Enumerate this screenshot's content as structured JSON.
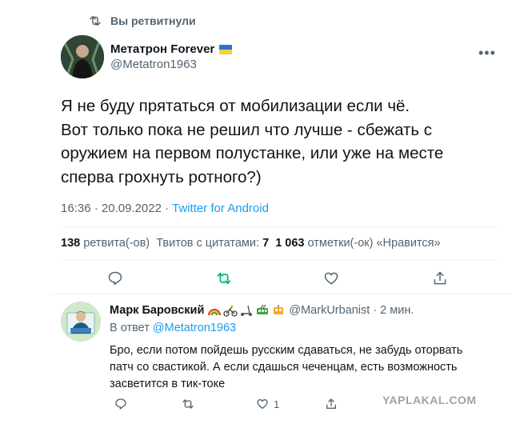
{
  "retweet_header": {
    "label": "Вы ретвитнули"
  },
  "tweet": {
    "author_name": "Метатрон Forever",
    "author_handle": "@Metatron1963",
    "text_lines": [
      "Я не буду прятаться от мобилизации если чё.",
      "Вот только пока не решил что лучше - сбежать с",
      "оружием на первом полустанке, или уже на месте",
      "сперва грохнуть ротного?)"
    ],
    "time": "16:36",
    "date": "20.09.2022",
    "separator": "·",
    "source": "Twitter for Android",
    "stats": {
      "retweets_count": "138",
      "retweets_label": "ретвита(-ов)",
      "quotes_label": "Твитов с цитатами:",
      "quotes_count": "7",
      "likes_count": "1 063",
      "likes_label": "отметки(-ок) «Нравится»"
    }
  },
  "reply": {
    "author_name": "Марк Баровский",
    "author_handle": "@MarkUrbanist",
    "time_ago": "· 2 мин.",
    "reply_to_label": "В ответ",
    "reply_to_handle": "@Metatron1963",
    "text_lines": [
      "Бро, если потом пойдешь русским сдаваться, не забудь оторвать",
      "патч со свастикой. А если сдашься чеченцам, есть возможность",
      "засветится в тик-токе"
    ],
    "like_count": "1"
  },
  "icons": [
    "retweet-icon",
    "more-icon",
    "reply-icon",
    "like-icon",
    "share-icon",
    "flag-ua-icon"
  ],
  "colors": {
    "accent": "#1d9bf0",
    "retweet_green": "#00ba7c",
    "muted": "#536471",
    "text": "#0f1419"
  },
  "watermark": "YAPLAKAL.COM"
}
